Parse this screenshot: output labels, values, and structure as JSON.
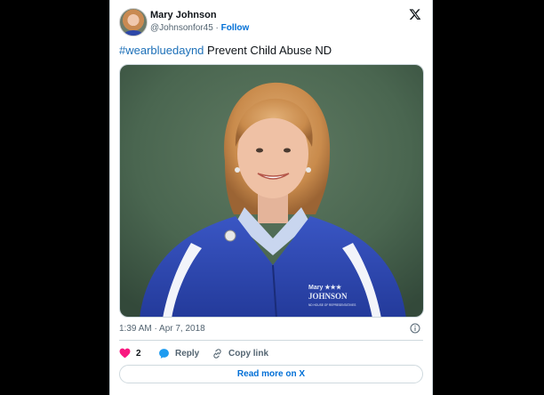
{
  "tweet": {
    "author": {
      "name": "Mary Johnson",
      "handle": "@Johnsonfor45",
      "separator": " · ",
      "follow_label": "Follow"
    },
    "text": {
      "hashtag": "#wearbluedaynd",
      "body": " Prevent Child Abuse ND"
    },
    "media": {
      "jacket_lines": [
        "Mary ★★★",
        "JOHNSON",
        "ND HOUSE OF REPRESENTATIVES"
      ]
    },
    "timestamp": "1:39 AM · Apr 7, 2018",
    "actions": {
      "like_count": "2",
      "reply_label": "Reply",
      "copy_label": "Copy link"
    },
    "read_more_label": "Read more on X"
  },
  "colors": {
    "background": "#000000",
    "card": "#ffffff",
    "link_blue": "#1d70b8",
    "like_red": "#f91880",
    "reply_blue": "#1d9bf0"
  },
  "icons": [
    "x-logo-icon",
    "info-icon",
    "heart-icon",
    "reply-bubble-icon",
    "link-icon"
  ]
}
